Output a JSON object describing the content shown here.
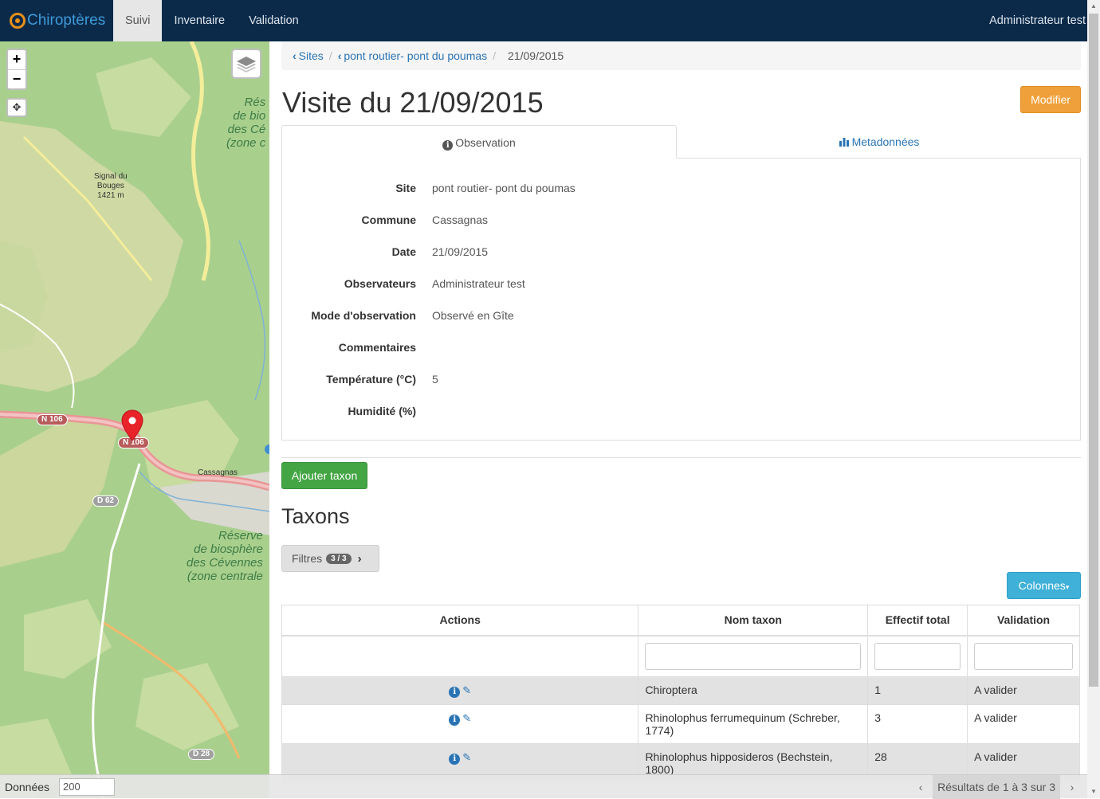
{
  "navbar": {
    "brand": "Chiroptères",
    "items": [
      {
        "label": "Suivi",
        "active": true
      },
      {
        "label": "Inventaire",
        "active": false
      },
      {
        "label": "Validation",
        "active": false
      }
    ],
    "user": "Administrateur test"
  },
  "map": {
    "zoom_in": "+",
    "zoom_out": "−",
    "labels": {
      "reserve_top": "Rés\nde bio\ndes Cé\n(zone c",
      "signal": "Signal du\nBouges\n1421 m",
      "cassagnas": "Cassagnas",
      "reserve_bottom": "Réserve\nde biosphère\ndes Cévennes\n(zone centrale"
    },
    "roads": [
      "N 106",
      "N 106",
      "D 62",
      "D 28"
    ]
  },
  "breadcrumb": {
    "sites": "Sites",
    "site": "pont routier- pont du poumas",
    "current": "21/09/2015"
  },
  "page": {
    "title": "Visite du 21/09/2015",
    "modifier": "Modifier"
  },
  "tabs": {
    "observation": "Observation",
    "metadonnees": "Metadonnées"
  },
  "fields": [
    {
      "label": "Site",
      "value": "pont routier- pont du poumas"
    },
    {
      "label": "Commune",
      "value": "Cassagnas"
    },
    {
      "label": "Date",
      "value": "21/09/2015"
    },
    {
      "label": "Observateurs",
      "value": "Administrateur test"
    },
    {
      "label": "Mode d'observation",
      "value": "Observé en Gîte"
    },
    {
      "label": "Commentaires",
      "value": ""
    },
    {
      "label": "Température (°C)",
      "value": "5"
    },
    {
      "label": "Humidité (%)",
      "value": ""
    }
  ],
  "taxons": {
    "add_button": "Ajouter taxon",
    "heading": "Taxons",
    "filters_label": "Filtres",
    "filters_badge": "3 / 3",
    "columns_button": "Colonnes",
    "headers": [
      "Actions",
      "Nom taxon",
      "Effectif total",
      "Validation"
    ],
    "rows": [
      {
        "nom": "Chiroptera",
        "effectif": "1",
        "validation": "A valider"
      },
      {
        "nom": "Rhinolophus ferrumequinum (Schreber, 1774)",
        "effectif": "3",
        "validation": "A valider"
      },
      {
        "nom": "Rhinolophus hipposideros (Bechstein, 1800)",
        "effectif": "28",
        "validation": "A valider"
      }
    ]
  },
  "bottombar": {
    "label": "Données",
    "value": "200",
    "results": "Résultats de 1 à 3 sur 3"
  },
  "colors": {
    "navbar": "#0b2a4a",
    "link": "#2a74b5",
    "modifier": "#f0a03a",
    "add": "#43a543",
    "colonnes": "#3fb0d8",
    "marker": "#e8232a"
  }
}
